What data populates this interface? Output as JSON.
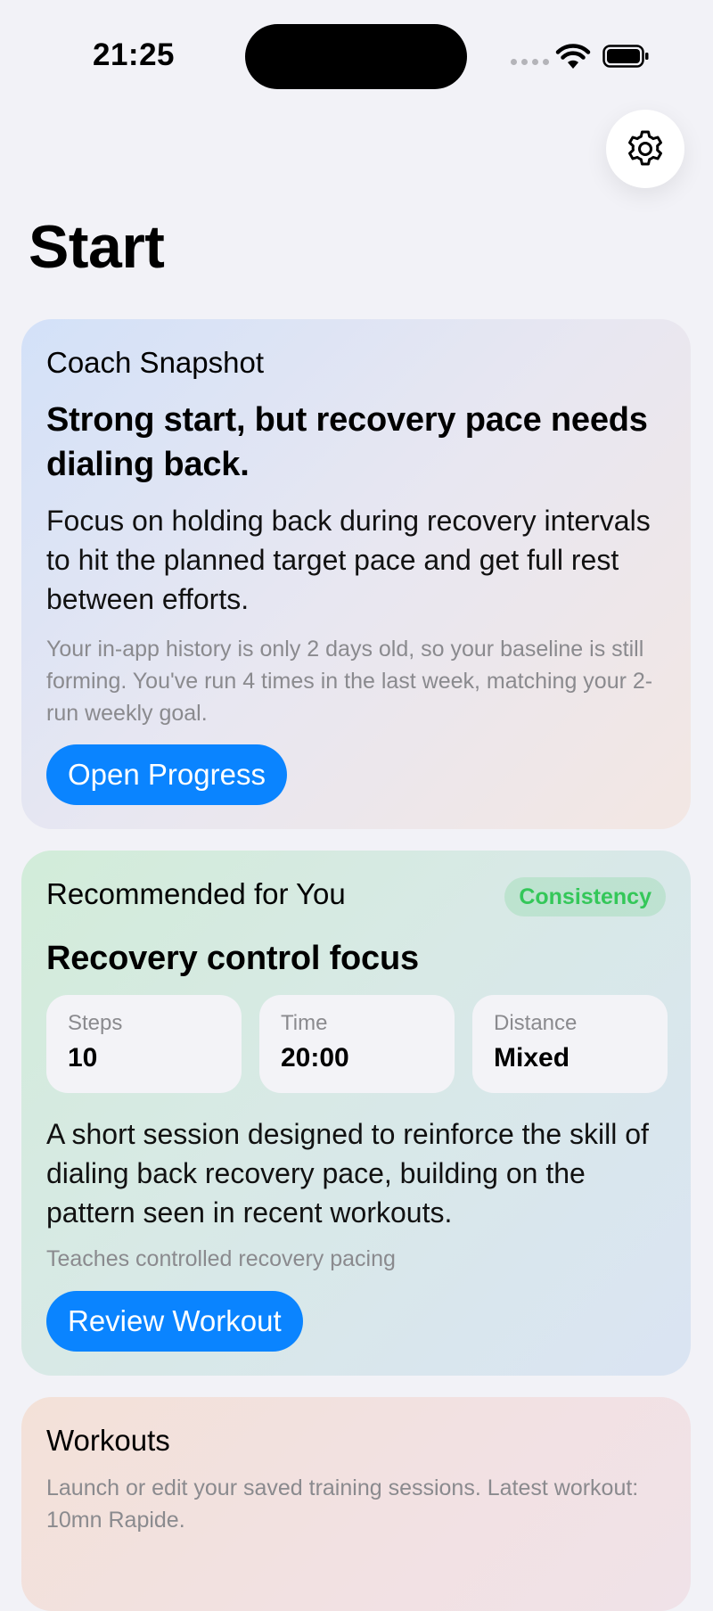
{
  "status_bar": {
    "time": "21:25",
    "icons": [
      "cellular-signal-icon",
      "wifi-icon",
      "battery-icon"
    ]
  },
  "settings_icon": "gear-icon",
  "page": {
    "title": "Start"
  },
  "coach_snapshot": {
    "label": "Coach Snapshot",
    "headline": "Strong start, but recovery pace needs dialing back.",
    "body": "Focus on holding back during recovery intervals to hit the planned target pace and get full rest between efforts.",
    "note": "Your in-app history is only 2 days old, so your baseline is still forming. You've run 4 times in the last week, matching your 2-run weekly goal.",
    "button_label": "Open Progress"
  },
  "recommended": {
    "label": "Recommended for You",
    "tag": "Consistency",
    "title": "Recovery control focus",
    "stats": [
      {
        "label": "Steps",
        "value": "10"
      },
      {
        "label": "Time",
        "value": "20:00"
      },
      {
        "label": "Distance",
        "value": "Mixed"
      }
    ],
    "body": "A short session designed to reinforce the skill of dialing back recovery pace, building on the pattern seen in recent workouts.",
    "note": "Teaches controlled recovery pacing",
    "button_label": "Review Workout"
  },
  "workouts": {
    "label": "Workouts",
    "description": "Launch or edit your saved training sessions. Latest workout: 10mn Rapide."
  },
  "colors": {
    "accent": "#0a84ff",
    "tag_green": "#34c759",
    "background": "#f2f2f7"
  }
}
